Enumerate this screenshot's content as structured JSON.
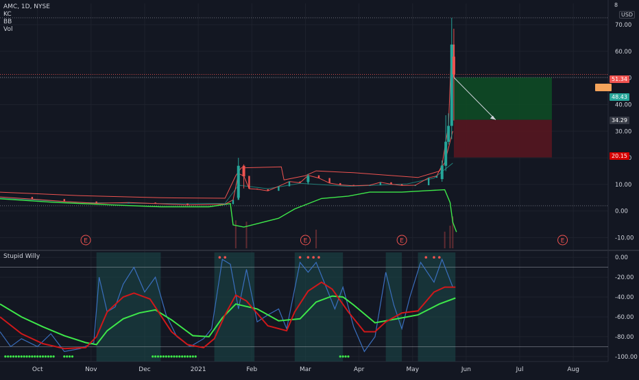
{
  "header": {
    "symbol_line": "AMC, 1D, NYSE",
    "indicators": [
      "KC",
      "BB",
      "Vol"
    ]
  },
  "currency_label": "USD",
  "corner_label": "8",
  "oscillator_title": "Stupid Willy",
  "earnings_marker": "E",
  "price_pills": [
    {
      "text": "51.34",
      "color": "#f05350"
    },
    {
      "text": "48.43",
      "color": "#26a69a"
    },
    {
      "text": "34.29",
      "color": "#363a45"
    },
    {
      "text": "20.15",
      "color": "#d50000"
    }
  ],
  "colors": {
    "background": "#131722",
    "grid": "#1e222d",
    "up": "#26a69a",
    "down": "#ef5350",
    "keltner": "#ef5350",
    "bollinger": "#26a69a",
    "lower_band": "#3ee84a",
    "willr": "#3a6fbf",
    "signal_fast": "#3ee84a",
    "signal_slow_down": "#d0181a",
    "profit_zone": "#0e4d24",
    "loss_zone": "#5a1620"
  },
  "chart_data": [
    {
      "type": "candlestick",
      "title": "AMC, 1D, NYSE",
      "ylabel": "USD",
      "ylim": [
        -14,
        78
      ],
      "yticks": [
        -10,
        0,
        10,
        20,
        30,
        40,
        50,
        60,
        70
      ],
      "ytick_labels": [
        "-10.00",
        "0.00",
        "10.00",
        "20.00",
        "30.00",
        "40.00",
        "50.00",
        "60.00",
        "70.00"
      ],
      "x_categories": [
        "Oct",
        "Nov",
        "Dec",
        "2021",
        "Feb",
        "Mar",
        "Apr",
        "May",
        "Jun",
        "Jul",
        "Aug"
      ],
      "xlim": [
        0,
        11.35
      ],
      "x_tick_positions": [
        0.7,
        1.7,
        2.7,
        3.7,
        4.7,
        5.7,
        6.7,
        7.7,
        8.7,
        9.7,
        10.7
      ],
      "horizontal_levels": [
        72.6,
        51.34,
        50.2,
        2.0
      ],
      "closing_path": [
        [
          0,
          5.3
        ],
        [
          0.6,
          4.5
        ],
        [
          1.2,
          3.6
        ],
        [
          1.8,
          2.9
        ],
        [
          2.4,
          3.2
        ],
        [
          2.9,
          2.8
        ],
        [
          3.5,
          2.3
        ],
        [
          4.2,
          2.6
        ],
        [
          4.35,
          4.2
        ],
        [
          4.45,
          14.1
        ],
        [
          4.55,
          13.2
        ],
        [
          4.65,
          8.4
        ],
        [
          4.8,
          8.2
        ],
        [
          5.0,
          7.6
        ],
        [
          5.2,
          9.3
        ],
        [
          5.4,
          11.1
        ],
        [
          5.6,
          10.6
        ],
        [
          5.75,
          13.4
        ],
        [
          5.95,
          12.4
        ],
        [
          6.15,
          10.5
        ],
        [
          6.35,
          9.8
        ],
        [
          6.6,
          9.5
        ],
        [
          6.9,
          9.7
        ],
        [
          7.1,
          10.8
        ],
        [
          7.3,
          10.1
        ],
        [
          7.5,
          9.6
        ],
        [
          7.75,
          9.7
        ],
        [
          8.0,
          12.5
        ],
        [
          8.15,
          13.2
        ],
        [
          8.25,
          17.2
        ],
        [
          8.32,
          26.1
        ],
        [
          8.37,
          32.0
        ],
        [
          8.43,
          62.55
        ],
        [
          8.47,
          50.2
        ]
      ],
      "candles": [
        {
          "x": 4.45,
          "open": 5.0,
          "high": 20.0,
          "low": 4.5,
          "close": 17.0
        },
        {
          "x": 4.55,
          "open": 17.0,
          "high": 17.5,
          "low": 8.5,
          "close": 13.0
        },
        {
          "x": 5.75,
          "open": 11.0,
          "high": 14.0,
          "low": 10.0,
          "close": 13.0
        },
        {
          "x": 8.25,
          "open": 12.0,
          "high": 19.0,
          "low": 11.0,
          "close": 17.0
        },
        {
          "x": 8.32,
          "open": 17.0,
          "high": 36.0,
          "low": 15.0,
          "close": 26.0
        },
        {
          "x": 8.37,
          "open": 26.0,
          "high": 36.7,
          "low": 25.0,
          "close": 32.0
        },
        {
          "x": 8.43,
          "open": 32.0,
          "high": 72.6,
          "low": 27.0,
          "close": 62.55
        },
        {
          "x": 8.47,
          "open": 58.0,
          "high": 68.5,
          "low": 34.0,
          "close": 51.34
        }
      ],
      "keltner_upper": [
        [
          0,
          7.1
        ],
        [
          1.5,
          5.8
        ],
        [
          3.0,
          5.0
        ],
        [
          4.2,
          4.8
        ],
        [
          4.4,
          13.3
        ],
        [
          4.5,
          16.2
        ],
        [
          5.25,
          16.6
        ],
        [
          5.3,
          11.7
        ],
        [
          5.7,
          13.3
        ],
        [
          5.9,
          15.1
        ],
        [
          6.6,
          14.4
        ],
        [
          7.8,
          12.6
        ],
        [
          8.2,
          15.0
        ],
        [
          8.3,
          18.2
        ],
        [
          8.45,
          30.0
        ]
      ],
      "bollinger_basis": [
        [
          0,
          4.9
        ],
        [
          1.5,
          3.2
        ],
        [
          3.0,
          2.8
        ],
        [
          4.2,
          2.9
        ],
        [
          4.45,
          9.7
        ],
        [
          5.0,
          8.4
        ],
        [
          5.6,
          10.4
        ],
        [
          6.5,
          9.3
        ],
        [
          7.6,
          10.2
        ],
        [
          8.1,
          12.4
        ],
        [
          8.45,
          18.0
        ]
      ],
      "lower_band": [
        [
          0,
          4.6
        ],
        [
          1.0,
          3.3
        ],
        [
          2.0,
          2.4
        ],
        [
          3.0,
          1.6
        ],
        [
          3.9,
          1.6
        ],
        [
          4.3,
          2.8
        ],
        [
          4.35,
          -5.2
        ],
        [
          4.55,
          -6.0
        ],
        [
          5.2,
          -2.7
        ],
        [
          5.5,
          0.8
        ],
        [
          6.0,
          4.7
        ],
        [
          6.5,
          5.6
        ],
        [
          6.9,
          7.1
        ],
        [
          7.5,
          7.1
        ],
        [
          8.0,
          7.7
        ],
        [
          8.3,
          8.0
        ],
        [
          8.4,
          3.2
        ],
        [
          8.45,
          -4.2
        ],
        [
          8.52,
          -7.9
        ]
      ],
      "volume_spikes": [
        [
          4.4,
          4.2
        ],
        [
          4.6,
          4.0
        ],
        [
          5.9,
          2.8
        ],
        [
          8.3,
          2.5
        ],
        [
          8.4,
          3.4
        ],
        [
          8.45,
          4.8
        ]
      ],
      "earnings_x": [
        1.6,
        5.7,
        7.5,
        10.5
      ],
      "trade": {
        "entry": 50.2,
        "target": 34.29,
        "stop": 20.15,
        "x_start": 8.47,
        "x_end": 10.3,
        "arrow_from": [
          8.47,
          50.2
        ],
        "arrow_to": [
          9.25,
          34.29
        ]
      }
    },
    {
      "type": "line",
      "title": "Stupid Willy",
      "ylim": [
        -105,
        5
      ],
      "yticks": [
        -100,
        -80,
        -60,
        -40,
        -20,
        0
      ],
      "ytick_labels": [
        "-100.00",
        "-80.00",
        "-60.00",
        "-40.00",
        "-20.00",
        "0.00"
      ],
      "reference_levels": [
        -10,
        -90
      ],
      "shaded_ranges": [
        [
          1.8,
          3.0
        ],
        [
          4.0,
          4.75
        ],
        [
          5.5,
          6.4
        ],
        [
          7.2,
          7.5
        ],
        [
          7.8,
          8.5
        ]
      ],
      "series": [
        {
          "name": "",
          "points": [
            [
              0,
              -75
            ],
            [
              0.2,
              -90
            ],
            [
              0.4,
              -82
            ],
            [
              0.7,
              -90
            ],
            [
              0.95,
              -77
            ],
            [
              1.2,
              -95
            ],
            [
              1.5,
              -92
            ],
            [
              1.75,
              -86
            ],
            [
              1.85,
              -20
            ],
            [
              2.0,
              -55
            ],
            [
              2.15,
              -50
            ],
            [
              2.3,
              -27
            ],
            [
              2.5,
              -10
            ],
            [
              2.7,
              -35
            ],
            [
              2.9,
              -20
            ],
            [
              3.1,
              -58
            ],
            [
              3.3,
              -80
            ],
            [
              3.55,
              -90
            ],
            [
              3.8,
              -82
            ],
            [
              3.95,
              -72
            ],
            [
              4.15,
              -2
            ],
            [
              4.3,
              -7
            ],
            [
              4.45,
              -52
            ],
            [
              4.6,
              -12
            ],
            [
              4.8,
              -65
            ],
            [
              5.0,
              -58
            ],
            [
              5.2,
              -52
            ],
            [
              5.35,
              -72
            ],
            [
              5.6,
              -5
            ],
            [
              5.75,
              -15
            ],
            [
              5.9,
              -5
            ],
            [
              6.05,
              -25
            ],
            [
              6.25,
              -52
            ],
            [
              6.4,
              -30
            ],
            [
              6.6,
              -70
            ],
            [
              6.8,
              -95
            ],
            [
              7.0,
              -80
            ],
            [
              7.2,
              -15
            ],
            [
              7.35,
              -48
            ],
            [
              7.5,
              -72
            ],
            [
              7.65,
              -40
            ],
            [
              7.85,
              -5
            ],
            [
              8.1,
              -25
            ],
            [
              8.25,
              -2
            ],
            [
              8.45,
              -30
            ]
          ]
        },
        {
          "name": "",
          "points": [
            [
              0,
              -47
            ],
            [
              0.4,
              -60
            ],
            [
              0.8,
              -70
            ],
            [
              1.2,
              -79
            ],
            [
              1.6,
              -86
            ],
            [
              1.8,
              -88
            ],
            [
              2.0,
              -74
            ],
            [
              2.3,
              -62
            ],
            [
              2.6,
              -56
            ],
            [
              2.9,
              -53
            ],
            [
              3.2,
              -63
            ],
            [
              3.6,
              -79
            ],
            [
              3.9,
              -80
            ],
            [
              4.15,
              -61
            ],
            [
              4.4,
              -47
            ],
            [
              4.8,
              -52
            ],
            [
              5.2,
              -64
            ],
            [
              5.6,
              -62
            ],
            [
              5.9,
              -45
            ],
            [
              6.2,
              -39
            ],
            [
              6.4,
              -40
            ],
            [
              6.6,
              -48
            ],
            [
              7.0,
              -66
            ],
            [
              7.3,
              -63
            ],
            [
              7.6,
              -60
            ],
            [
              7.8,
              -58
            ],
            [
              8.2,
              -47
            ],
            [
              8.5,
              -41
            ]
          ]
        },
        {
          "name": "",
          "points": [
            [
              0,
              -60
            ],
            [
              0.4,
              -77
            ],
            [
              0.8,
              -87
            ],
            [
              1.2,
              -92
            ],
            [
              1.6,
              -91
            ],
            [
              1.8,
              -80
            ],
            [
              2.0,
              -55
            ],
            [
              2.3,
              -40
            ],
            [
              2.5,
              -36
            ],
            [
              2.8,
              -42
            ],
            [
              3.2,
              -75
            ],
            [
              3.5,
              -88
            ],
            [
              3.8,
              -91
            ],
            [
              4.0,
              -82
            ],
            [
              4.2,
              -58
            ],
            [
              4.4,
              -38
            ],
            [
              4.6,
              -44
            ],
            [
              5.0,
              -69
            ],
            [
              5.35,
              -74
            ],
            [
              5.5,
              -55
            ],
            [
              5.75,
              -34
            ],
            [
              6.0,
              -25
            ],
            [
              6.2,
              -32
            ],
            [
              6.5,
              -55
            ],
            [
              6.8,
              -75
            ],
            [
              7.0,
              -75
            ],
            [
              7.2,
              -65
            ],
            [
              7.5,
              -56
            ],
            [
              7.8,
              -54
            ],
            [
              8.1,
              -35
            ],
            [
              8.3,
              -30
            ],
            [
              8.5,
              -30
            ]
          ]
        }
      ],
      "bottom_markers": [
        [
          0.1,
          0.5
        ],
        [
          0.55,
          1.0
        ],
        [
          1.2,
          1.35
        ],
        [
          2.85,
          3.65
        ],
        [
          6.35,
          6.5
        ]
      ],
      "top_markers": [
        4.1,
        4.2,
        5.6,
        5.75,
        5.85,
        5.95,
        7.95,
        8.1,
        8.2
      ]
    }
  ]
}
